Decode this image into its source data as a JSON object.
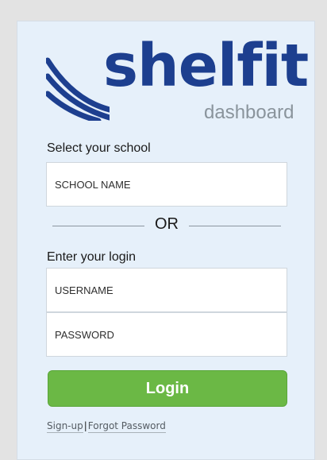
{
  "brand": {
    "wordmark": "shelfit",
    "subtitle": "dashboard",
    "logo_icon": "diagonal-stripes-icon",
    "primary_color": "#1d3f8f"
  },
  "school": {
    "label": "Select your school",
    "placeholder": "SCHOOL NAME"
  },
  "divider": {
    "text": "OR"
  },
  "login": {
    "label": "Enter your login",
    "username_placeholder": "USERNAME",
    "password_placeholder": "PASSWORD",
    "button_label": "Login",
    "button_color": "#6bb845"
  },
  "links": {
    "signup": "Sign-up",
    "separator": "|",
    "forgot": "Forgot Password"
  }
}
